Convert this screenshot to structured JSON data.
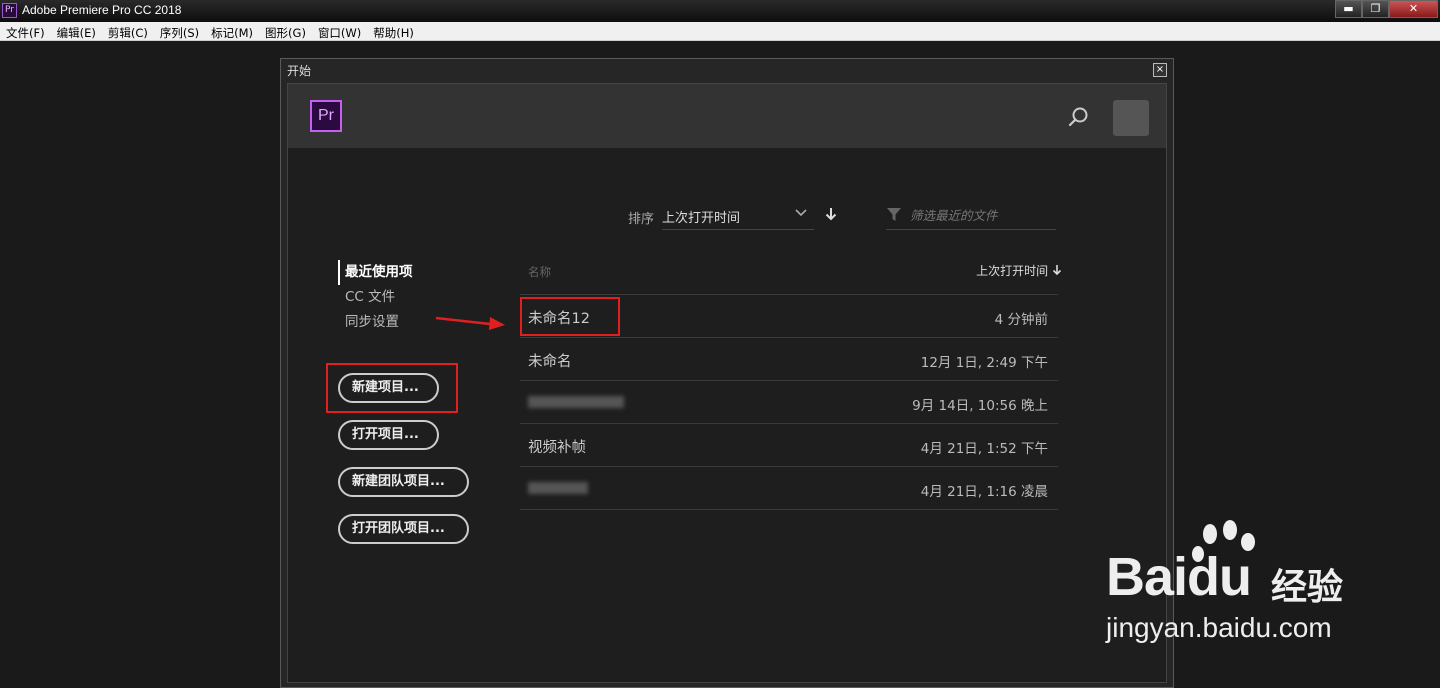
{
  "window": {
    "title": "Adobe Premiere Pro CC 2018",
    "app_icon_text": "Pr",
    "controls": {
      "minimize": "▬",
      "maximize": "❐",
      "close": "✕"
    }
  },
  "menubar": {
    "items": [
      "文件(F)",
      "编辑(E)",
      "剪辑(C)",
      "序列(S)",
      "标记(M)",
      "图形(G)",
      "窗口(W)",
      "帮助(H)"
    ]
  },
  "dialog": {
    "title": "开始",
    "close_glyph": "×",
    "logo_text": "Pr",
    "icons": {
      "search": "search-icon",
      "filter": "filter-icon",
      "sort_direction": "arrow-down-icon"
    },
    "colors": {
      "accent": "#c55ff0",
      "highlight": "#e02020"
    },
    "sort": {
      "label": "排序",
      "value": "上次打开时间"
    },
    "filter": {
      "placeholder": "筛选最近的文件"
    },
    "nav": {
      "active": "最近使用项",
      "items": [
        "CC 文件",
        "同步设置"
      ]
    },
    "buttons": {
      "new_project": "新建项目...",
      "open_project": "打开项目...",
      "new_team_project": "新建团队项目...",
      "open_team_project": "打开团队项目..."
    },
    "table": {
      "col_name": "名称",
      "col_time": "上次打开时间",
      "rows": [
        {
          "name": "未命名12",
          "time": "4 分钟前"
        },
        {
          "name": "未命名",
          "time": "12月 1日, 2:49 下午"
        },
        {
          "name": "",
          "time": "9月 14日, 10:56 晚上"
        },
        {
          "name": "视频补帧",
          "time": "4月 21日, 1:52 下午"
        },
        {
          "name": "",
          "time": "4月 21日, 1:16 凌晨"
        }
      ]
    }
  },
  "watermark": {
    "brand": "Bai",
    "brand_suffix": "du",
    "sub": "经验",
    "url": "jingyan.baidu.com"
  }
}
